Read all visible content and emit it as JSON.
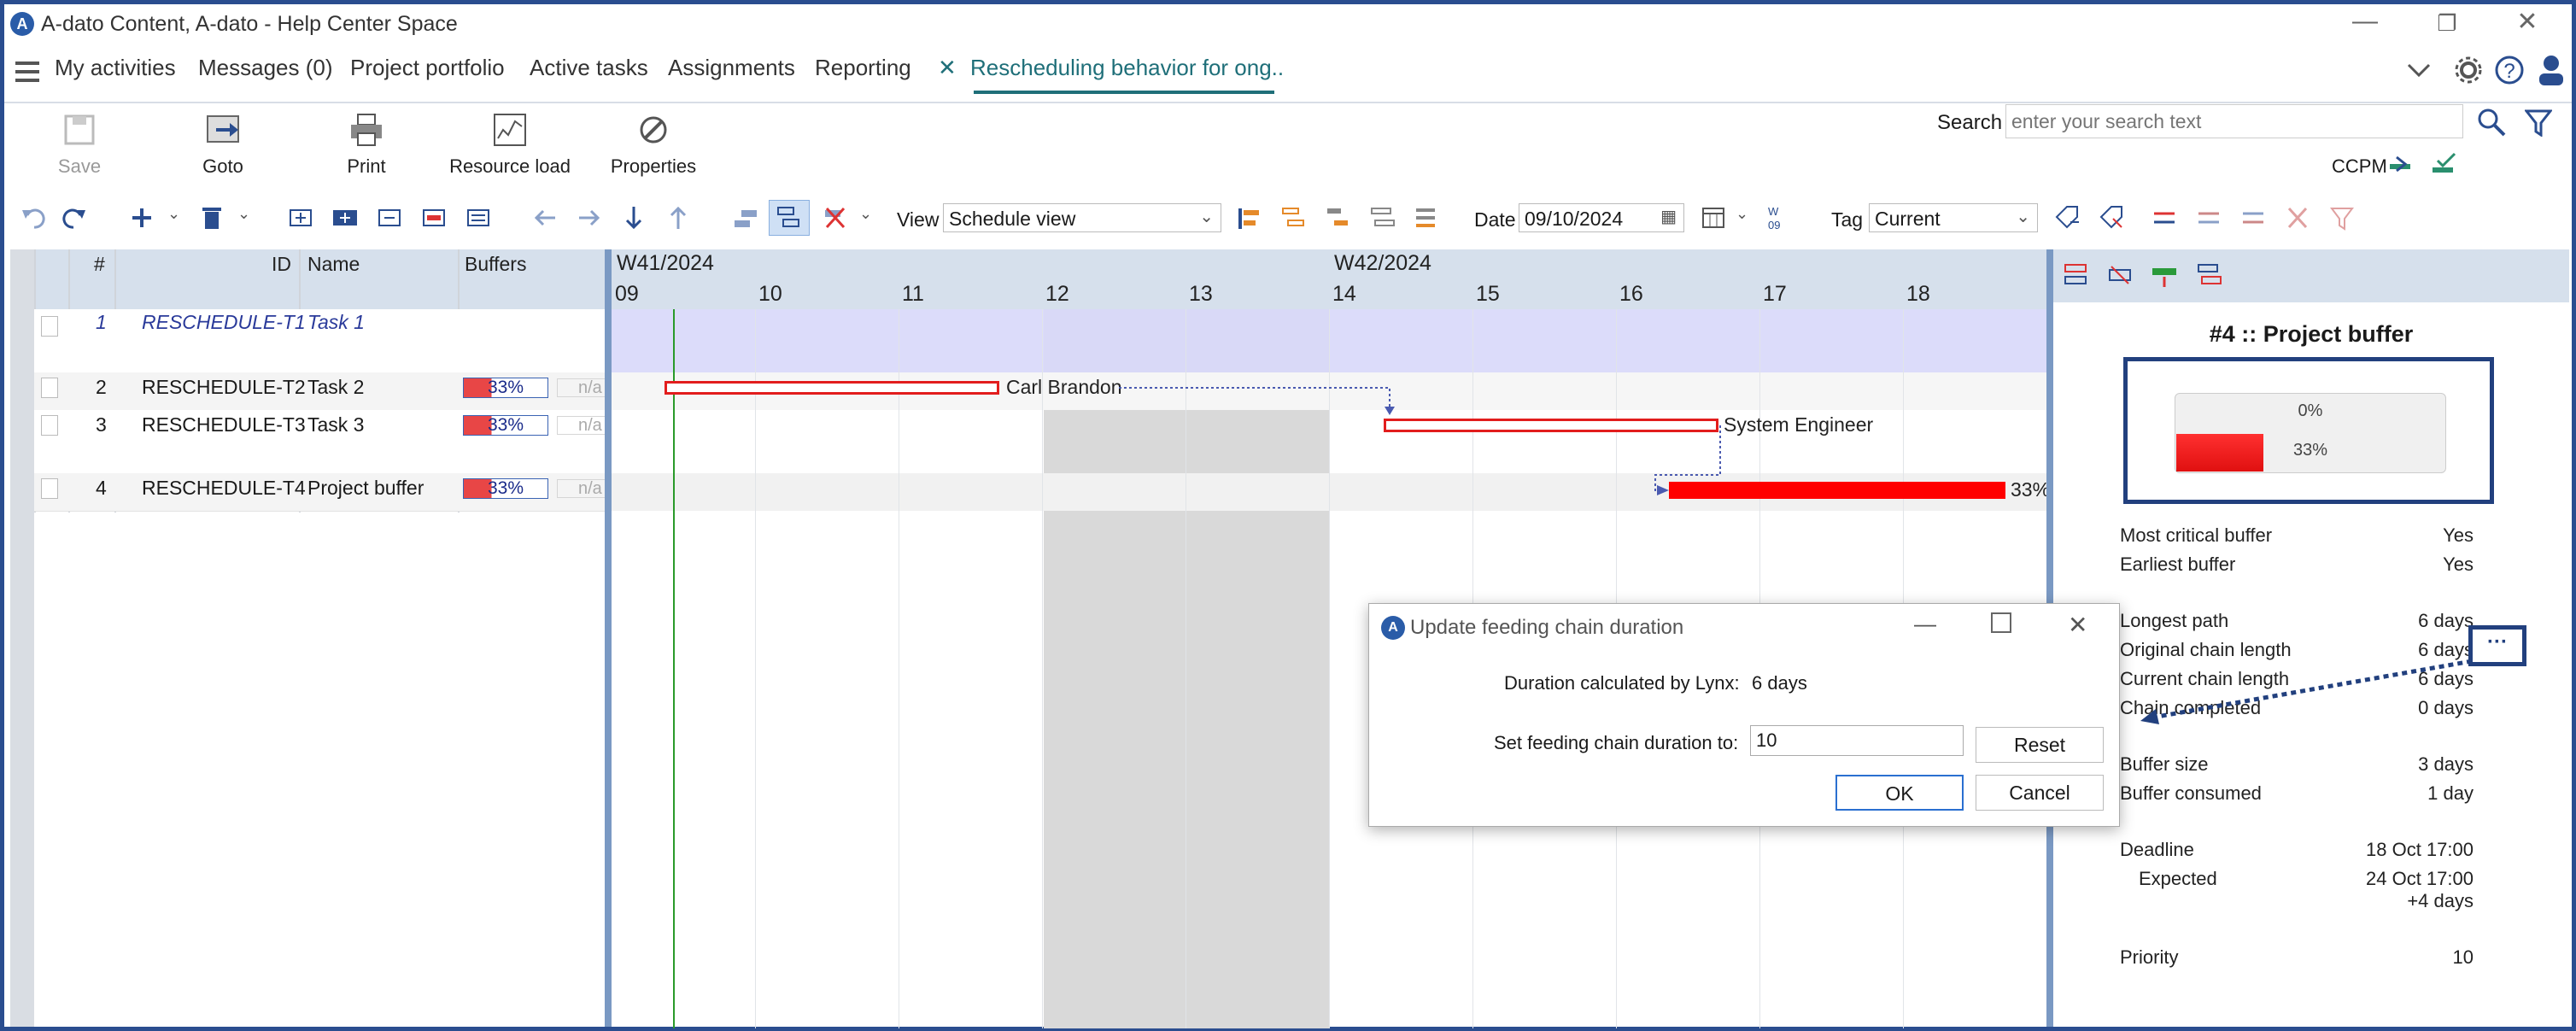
{
  "window": {
    "title": "A-dato Content, A-dato - Help Center Space",
    "minimize": "—",
    "restore": "❐",
    "close": "✕"
  },
  "menu": {
    "items": [
      "My activities",
      "Messages (0)",
      "Project portfolio",
      "Active tasks",
      "Assignments",
      "Reporting"
    ],
    "active_tab": "Rescheduling behavior for ong..",
    "active_tab_close": "✕"
  },
  "toolbar": {
    "save": "Save",
    "goto": "Goto",
    "print": "Print",
    "resource_load": "Resource load",
    "properties": "Properties",
    "search_label": "Search",
    "search_placeholder": "enter your search text",
    "ccpm": "CCPM",
    "view_label": "View",
    "view_value": "Schedule view",
    "date_label": "Date",
    "date_value": "09/10/2024",
    "tag_label": "Tag",
    "tag_value": "Current"
  },
  "grid": {
    "headers": {
      "num": "#",
      "id": "ID",
      "name": "Name",
      "buffers": "Buffers"
    },
    "rows": [
      {
        "num": "1",
        "id": "RESCHEDULE-T1",
        "name": "Task 1",
        "buffer": "",
        "na": ""
      },
      {
        "num": "2",
        "id": "RESCHEDULE-T2",
        "name": "Task 2",
        "buffer": "33%",
        "na": "n/a"
      },
      {
        "num": "3",
        "id": "RESCHEDULE-T3",
        "name": "Task 3",
        "buffer": "33%",
        "na": "n/a"
      },
      {
        "num": "4",
        "id": "RESCHEDULE-T4",
        "name": "Project buffer",
        "buffer": "33%",
        "na": "n/a"
      }
    ]
  },
  "gantt": {
    "weeks": [
      "W41/2024",
      "W42/2024"
    ],
    "days": [
      "09",
      "10",
      "11",
      "12",
      "13",
      "14",
      "15",
      "16",
      "17",
      "18"
    ],
    "task2_resource": "Carl Brandon",
    "task3_resource": "System Engineer",
    "buffer_label": "33%"
  },
  "panel": {
    "title": "#4 :: Project buffer",
    "gauge_top": "0%",
    "gauge_bottom": "33%",
    "gauge_fill": 0.33,
    "rows": [
      {
        "label": "Most critical buffer",
        "value": "Yes"
      },
      {
        "label": "Earliest buffer",
        "value": "Yes"
      },
      {
        "label": "Longest path",
        "value": "6 days"
      },
      {
        "label": "Original chain length",
        "value": "6 days"
      },
      {
        "label": "Current chain length",
        "value": "6 days"
      },
      {
        "label": "Chain completed",
        "value": "0 days"
      },
      {
        "label": "Buffer size",
        "value": "3 days"
      },
      {
        "label": "Buffer consumed",
        "value": "1 day"
      },
      {
        "label": "Deadline",
        "value": "18 Oct 17:00"
      },
      {
        "label": "Expected",
        "value": "24 Oct 17:00"
      },
      {
        "label": "",
        "value": "+4 days"
      },
      {
        "label": "Priority",
        "value": "10"
      }
    ],
    "ellipsis": "···"
  },
  "dialog": {
    "title": "Update feeding chain duration",
    "calc_label": "Duration calculated by Lynx:",
    "calc_value": "6 days",
    "set_label": "Set feeding chain duration to:",
    "set_value": "10",
    "reset": "Reset",
    "ok": "OK",
    "cancel": "Cancel"
  },
  "colors": {
    "accent": "#2a4d8f",
    "bar": "#ff0000",
    "tab_underline": "#1f6f79",
    "row1_bg": "#d8d8fa"
  }
}
